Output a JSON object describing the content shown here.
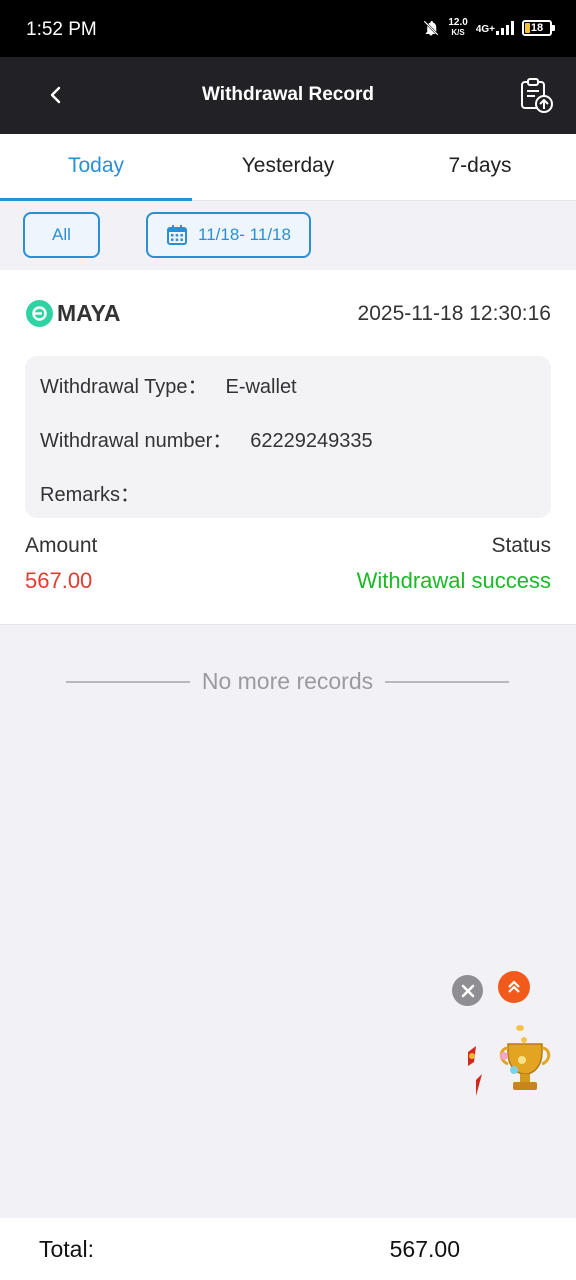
{
  "status_bar": {
    "time": "1:52 PM",
    "net_speed_value": "12.0",
    "net_speed_unit": "K/S",
    "network": "4G+",
    "battery": "18",
    "icons": [
      "bell-off-icon",
      "signal-icon",
      "battery-icon"
    ]
  },
  "header": {
    "title": "Withdrawal Record",
    "back_icon": "chevron-left-icon",
    "action_icon": "clipboard-upload-icon"
  },
  "tabs": [
    {
      "label": "Today",
      "active": true
    },
    {
      "label": "Yesterday",
      "active": false
    },
    {
      "label": "7-days",
      "active": false
    }
  ],
  "filters": {
    "type_label": "All",
    "date_range": "11/18- 11/18",
    "date_icon": "calendar-icon"
  },
  "record": {
    "channel": "MAYA",
    "datetime": "2025-11-18 12:30:16",
    "type_label": "Withdrawal Type：",
    "type_value": "E-wallet",
    "number_label": "Withdrawal number：",
    "number_value": "62229249335",
    "remarks_label": "Remarks：",
    "remarks_value": "",
    "amount_label": "Amount",
    "amount_value": "567.00",
    "status_label": "Status",
    "status_value": "Withdrawal success"
  },
  "end_message": "No more records",
  "floating": {
    "close_icon": "close-icon",
    "scroll_top_icon": "double-chevron-up-icon",
    "promo_icon": "trophy-icon"
  },
  "footer": {
    "total_label": "Total:",
    "total_value": "567.00"
  },
  "colors": {
    "accent": "#2a8fd4",
    "amount": "#e53b2e",
    "success": "#1bb928",
    "header_bg": "#222226"
  }
}
